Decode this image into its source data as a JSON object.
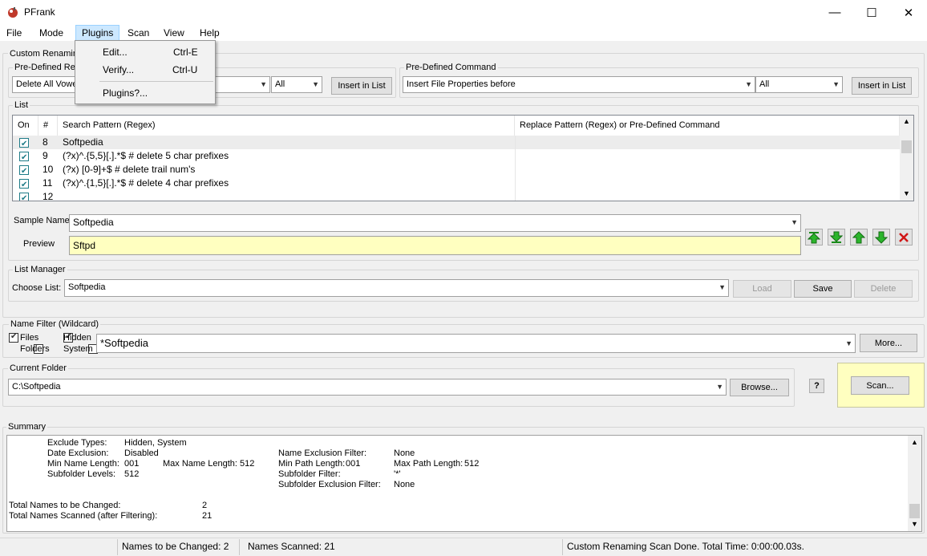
{
  "window": {
    "title": "PFrank",
    "minimize": "—",
    "maximize": "☐",
    "close": "✕"
  },
  "menu": {
    "file": "File",
    "mode": "Mode",
    "plugins": "Plugins",
    "scan": "Scan",
    "view": "View",
    "help": "Help"
  },
  "plugins_menu": {
    "edit": "Edit...",
    "edit_shortcut": "Ctrl-E",
    "verify": "Verify...",
    "verify_shortcut": "Ctrl-U",
    "about": "Plugins?..."
  },
  "custom_renaming": {
    "group_label": "Custom Renaming",
    "predefined_regex_label": "Pre-Defined Re",
    "regex_combo_value": "Delete All Vowe",
    "regex_scope_value": "All",
    "insert_button_left": "Insert in List",
    "predefined_command_label": "Pre-Defined Command",
    "command_combo_value": "Insert File Properties before",
    "command_scope_value": "All",
    "insert_button_right": "Insert in List"
  },
  "list": {
    "group_label": "List",
    "columns": {
      "on": "On",
      "num": "#",
      "search": "Search Pattern (Regex)",
      "replace": "Replace Pattern (Regex)  or  Pre-Defined Command"
    },
    "rows": [
      {
        "num": "8",
        "search": "Softpedia",
        "replace": ""
      },
      {
        "num": "9",
        "search": "(?x)^.{5,5}[.].*$  # delete 5 char prefixes",
        "replace": ""
      },
      {
        "num": "10",
        "search": "(?x) [0-9]+$   # delete trail num's",
        "replace": ""
      },
      {
        "num": "11",
        "search": "(?x)^.{1,5}[.].*$  # delete 4 char prefixes",
        "replace": ""
      },
      {
        "num": "12",
        "search": "",
        "replace": ""
      }
    ]
  },
  "sample": {
    "label": "Sample Name",
    "value": "Softpedia",
    "preview_label": "Preview",
    "preview_value": "Sftpd"
  },
  "list_manager": {
    "group_label": "List Manager",
    "choose_label": "Choose List:",
    "choose_value": "Softpedia",
    "load": "Load",
    "save": "Save",
    "delete": "Delete"
  },
  "name_filter": {
    "group_label": "Name Filter (Wildcard)",
    "files": "Files",
    "hidden": "Hidden",
    "folders": "Folders",
    "system": "System",
    "pattern": "*Softpedia",
    "more_button": "More..."
  },
  "current_folder": {
    "group_label": "Current Folder",
    "path": "C:\\Softpedia",
    "browse_button": "Browse...",
    "help_button": "?",
    "scan_button": "Scan..."
  },
  "summary": {
    "group_label": "Summary",
    "exclude_types_label": "Exclude Types:",
    "exclude_types_value": "Hidden, System",
    "date_exclusion_label": "Date Exclusion:",
    "date_exclusion_value": "Disabled",
    "min_name_label": "Min Name Length:",
    "min_name_value": "001",
    "max_name_label": "Max Name Length:",
    "max_name_value": "512",
    "subfolder_levels_label": "Subfolder Levels:",
    "subfolder_levels_value": "512",
    "name_exclusion_label": "Name Exclusion Filter:",
    "name_exclusion_value": "None",
    "min_path_label": "Min Path Length:",
    "min_path_value": "001",
    "max_path_label": "Max Path Length:",
    "max_path_value": "512",
    "subfolder_filter_label": "Subfolder Filter:",
    "subfolder_filter_value": "'*'",
    "subfolder_exclusion_label": "Subfolder Exclusion Filter:",
    "subfolder_exclusion_value": "None",
    "total_changed_label": "Total Names to be Changed:",
    "total_changed_value": "2",
    "total_scanned_label": "Total Names Scanned (after Filtering):",
    "total_scanned_value": "21"
  },
  "status": {
    "names_changed": "Names to be Changed: 2",
    "names_scanned": "Names Scanned: 21",
    "message": "Custom Renaming Scan Done.  Total Time: 0:00:00.03s."
  },
  "colors": {
    "preview_bg": "#ffffc0",
    "scan_panel_bg": "#ffffc0",
    "menu_highlight": "#cce8ff",
    "check_teal": "#1e7b87"
  }
}
